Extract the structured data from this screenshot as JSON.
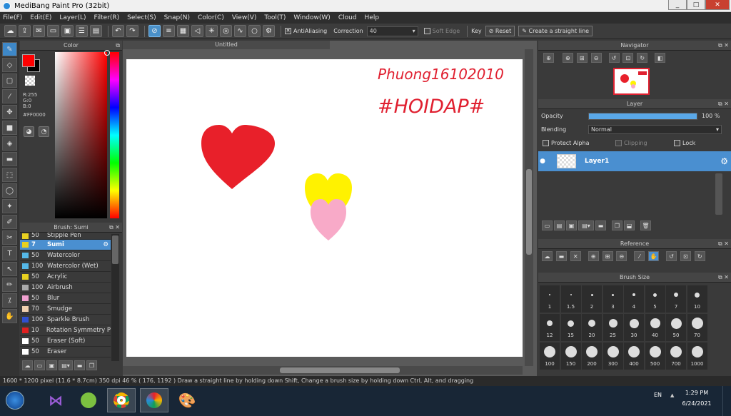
{
  "window": {
    "title": "MediBang Paint Pro (32bit)",
    "min": "_",
    "max": "□",
    "close": "✕"
  },
  "menu": [
    "File(F)",
    "Edit(E)",
    "Layer(L)",
    "Filter(R)",
    "Select(S)",
    "Snap(N)",
    "Color(C)",
    "View(V)",
    "Tool(T)",
    "Window(W)",
    "Cloud",
    "Help"
  ],
  "toolbar": {
    "antialiasing_label": "AntiAliasing",
    "correction_label": "Correction",
    "correction_value": "40",
    "soft_edge_label": "Soft Edge",
    "key_label": "Key",
    "reset_label": "Reset",
    "straight_line_label": "Create a straight line"
  },
  "color_panel": {
    "title": "Color",
    "r": "R:255",
    "g": "G:0",
    "b": "B:0",
    "hex": "#FF0000",
    "fg_color": "#ff0000",
    "bg_color": "#000000"
  },
  "brush_panel": {
    "title": "Brush: Sumi",
    "items": [
      {
        "size": "50",
        "name": "Stipple Pen",
        "color": "#e8d020"
      },
      {
        "size": "7",
        "name": "Sumi",
        "color": "#e8d020",
        "selected": true
      },
      {
        "size": "50",
        "name": "Watercolor",
        "color": "#55b8e8"
      },
      {
        "size": "100",
        "name": "Watercolor (Wet)",
        "color": "#55b8e8"
      },
      {
        "size": "50",
        "name": "Acrylic",
        "color": "#e8d020"
      },
      {
        "size": "100",
        "name": "Airbrush",
        "color": "#aaaaaa"
      },
      {
        "size": "50",
        "name": "Blur",
        "color": "#f0a0d0"
      },
      {
        "size": "70",
        "name": "Smudge",
        "color": "#f0d0b0"
      },
      {
        "size": "100",
        "name": "Sparkle Brush",
        "color": "#3050d0"
      },
      {
        "size": "10",
        "name": "Rotation Symmetry P",
        "color": "#e02020"
      },
      {
        "size": "50",
        "name": "Eraser (Soft)",
        "color": "#ffffff"
      },
      {
        "size": "50",
        "name": "Eraser",
        "color": "#ffffff"
      }
    ]
  },
  "document": {
    "tab": "Untitled",
    "hearts": [
      {
        "name": "red-heart",
        "color": "#e8202a"
      },
      {
        "name": "yellow-heart",
        "color": "#fff200"
      },
      {
        "name": "pink-heart",
        "color": "#f8aac8"
      }
    ],
    "handwriting_line1": "Phuong16102010",
    "handwriting_line2": "#HOIDAP#",
    "handwriting_color": "#e02030"
  },
  "navigator": {
    "title": "Navigator"
  },
  "layer_panel": {
    "title": "Layer",
    "opacity_label": "Opacity",
    "opacity_value": "100 %",
    "opacity_fraction": 1.0,
    "blending_label": "Blending",
    "blending_value": "Normal",
    "protect_alpha_label": "Protect Alpha",
    "clipping_label": "Clipping",
    "lock_label": "Lock",
    "layer_name": "Layer1"
  },
  "reference": {
    "title": "Reference"
  },
  "brush_size": {
    "title": "Brush Size",
    "row1": [
      "1",
      "1.5",
      "2",
      "3",
      "4",
      "5",
      "7",
      "10"
    ],
    "row2": [
      "12",
      "15",
      "20",
      "25",
      "30",
      "40",
      "50",
      "70"
    ],
    "row3": [
      "100",
      "150",
      "200",
      "300",
      "400",
      "500",
      "700",
      "1000"
    ]
  },
  "status": {
    "size": "1600 * 1200 pixel",
    "cm": "(11.6 * 8.7cm)",
    "dpi": "350 dpi",
    "zoom": "46 %",
    "coords": "( 176, 1192 )",
    "hint": "Draw a straight line by holding down Shift, Change a brush size by holding down Ctrl, Alt, and dragging"
  },
  "taskbar": {
    "lang": "EN",
    "time": "1:29 PM",
    "date": "6/24/2021"
  }
}
